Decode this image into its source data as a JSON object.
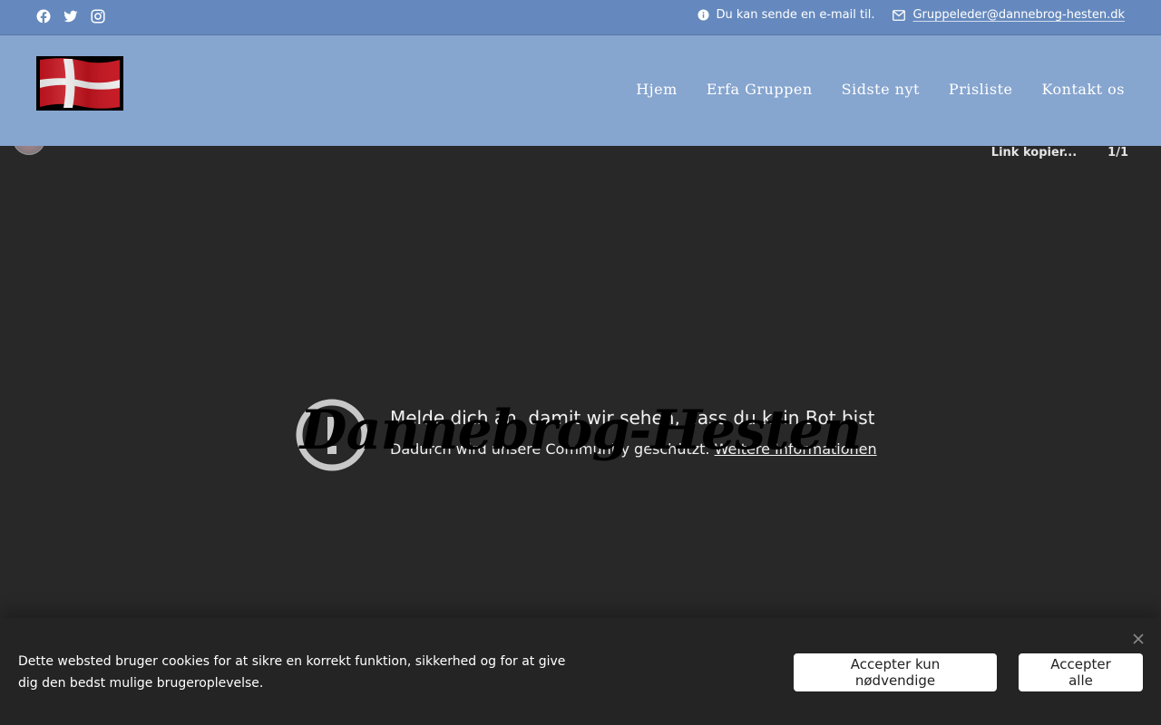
{
  "topbar": {
    "social_icons": [
      "facebook-icon",
      "twitter-icon",
      "instagram-icon"
    ],
    "info_text": "Du kan sende en e-mail til.",
    "email": "Gruppeleder@dannebrog-hesten.dk"
  },
  "header": {
    "nav": [
      "Hjem",
      "Erfa Gruppen",
      "Sidste nyt",
      "Prisliste",
      "Kontakt os"
    ]
  },
  "embed": {
    "link_copy": "Link kopier...",
    "counter": "1/1",
    "warning_title": "Melde dich an, damit wir sehen, dass du kein Bot bist",
    "warning_sub": "Dadurch wird unsere Community geschützt.",
    "more_info": "Weitere Informationen",
    "brand_overlay": "Dannebrog-Hesten"
  },
  "cookie": {
    "text": "Dette websted bruger cookies for at sikre en korrekt funktion, sikkerhed og for at give dig den bedst mulige brugeroplevelse.",
    "btn_necessary": "Accepter kun nødvendige",
    "btn_all": "Accepter alle"
  },
  "colors": {
    "topbar": "#6589be",
    "header": "#86a5cf",
    "embed_bg": "#282828",
    "cookie_bg": "#242424"
  }
}
